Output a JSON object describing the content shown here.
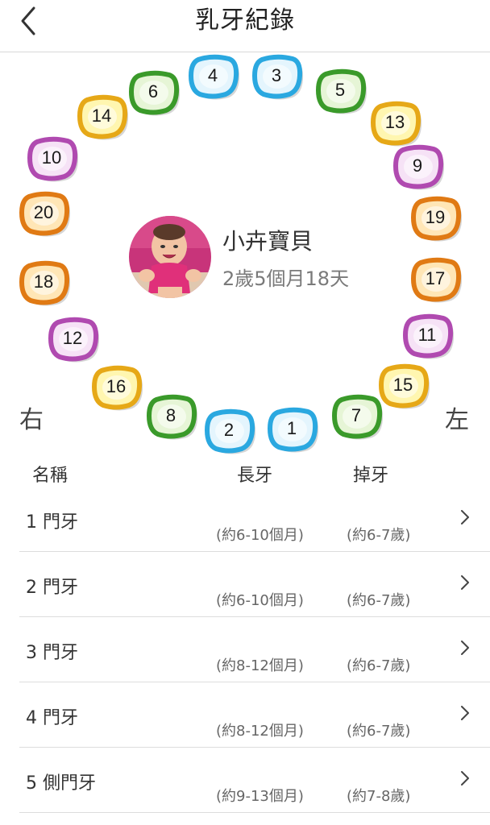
{
  "header": {
    "title": "乳牙紀錄"
  },
  "baby": {
    "name": "小卉寶貝",
    "age": "2歲5個月18天"
  },
  "sides": {
    "right": "右",
    "left": "左"
  },
  "colors": {
    "blue": "#2aa8e0",
    "green": "#3a9a2a",
    "yellow": "#e6a817",
    "purple": "#b04ab0",
    "orange": "#e07a14"
  },
  "teeth": [
    {
      "num": "4",
      "color": "blue"
    },
    {
      "num": "3",
      "color": "blue"
    },
    {
      "num": "6",
      "color": "green"
    },
    {
      "num": "5",
      "color": "green"
    },
    {
      "num": "14",
      "color": "yellow"
    },
    {
      "num": "13",
      "color": "yellow"
    },
    {
      "num": "10",
      "color": "purple"
    },
    {
      "num": "9",
      "color": "purple"
    },
    {
      "num": "20",
      "color": "orange"
    },
    {
      "num": "19",
      "color": "orange"
    },
    {
      "num": "18",
      "color": "orange"
    },
    {
      "num": "17",
      "color": "orange"
    },
    {
      "num": "12",
      "color": "purple"
    },
    {
      "num": "11",
      "color": "purple"
    },
    {
      "num": "16",
      "color": "yellow"
    },
    {
      "num": "15",
      "color": "yellow"
    },
    {
      "num": "8",
      "color": "green"
    },
    {
      "num": "7",
      "color": "green"
    },
    {
      "num": "2",
      "color": "blue"
    },
    {
      "num": "1",
      "color": "blue"
    }
  ],
  "list": {
    "headers": {
      "name": "名稱",
      "grow": "長牙",
      "lose": "掉牙"
    },
    "rows": [
      {
        "name": "1 門牙",
        "grow": "(約6-10個月)",
        "lose": "(約6-7歲)"
      },
      {
        "name": "2 門牙",
        "grow": "(約6-10個月)",
        "lose": "(約6-7歲)"
      },
      {
        "name": "3 門牙",
        "grow": "(約8-12個月)",
        "lose": "(約6-7歲)"
      },
      {
        "name": "4 門牙",
        "grow": "(約8-12個月)",
        "lose": "(約6-7歲)"
      },
      {
        "name": "5 側門牙",
        "grow": "(約9-13個月)",
        "lose": "(約7-8歲)"
      }
    ]
  }
}
